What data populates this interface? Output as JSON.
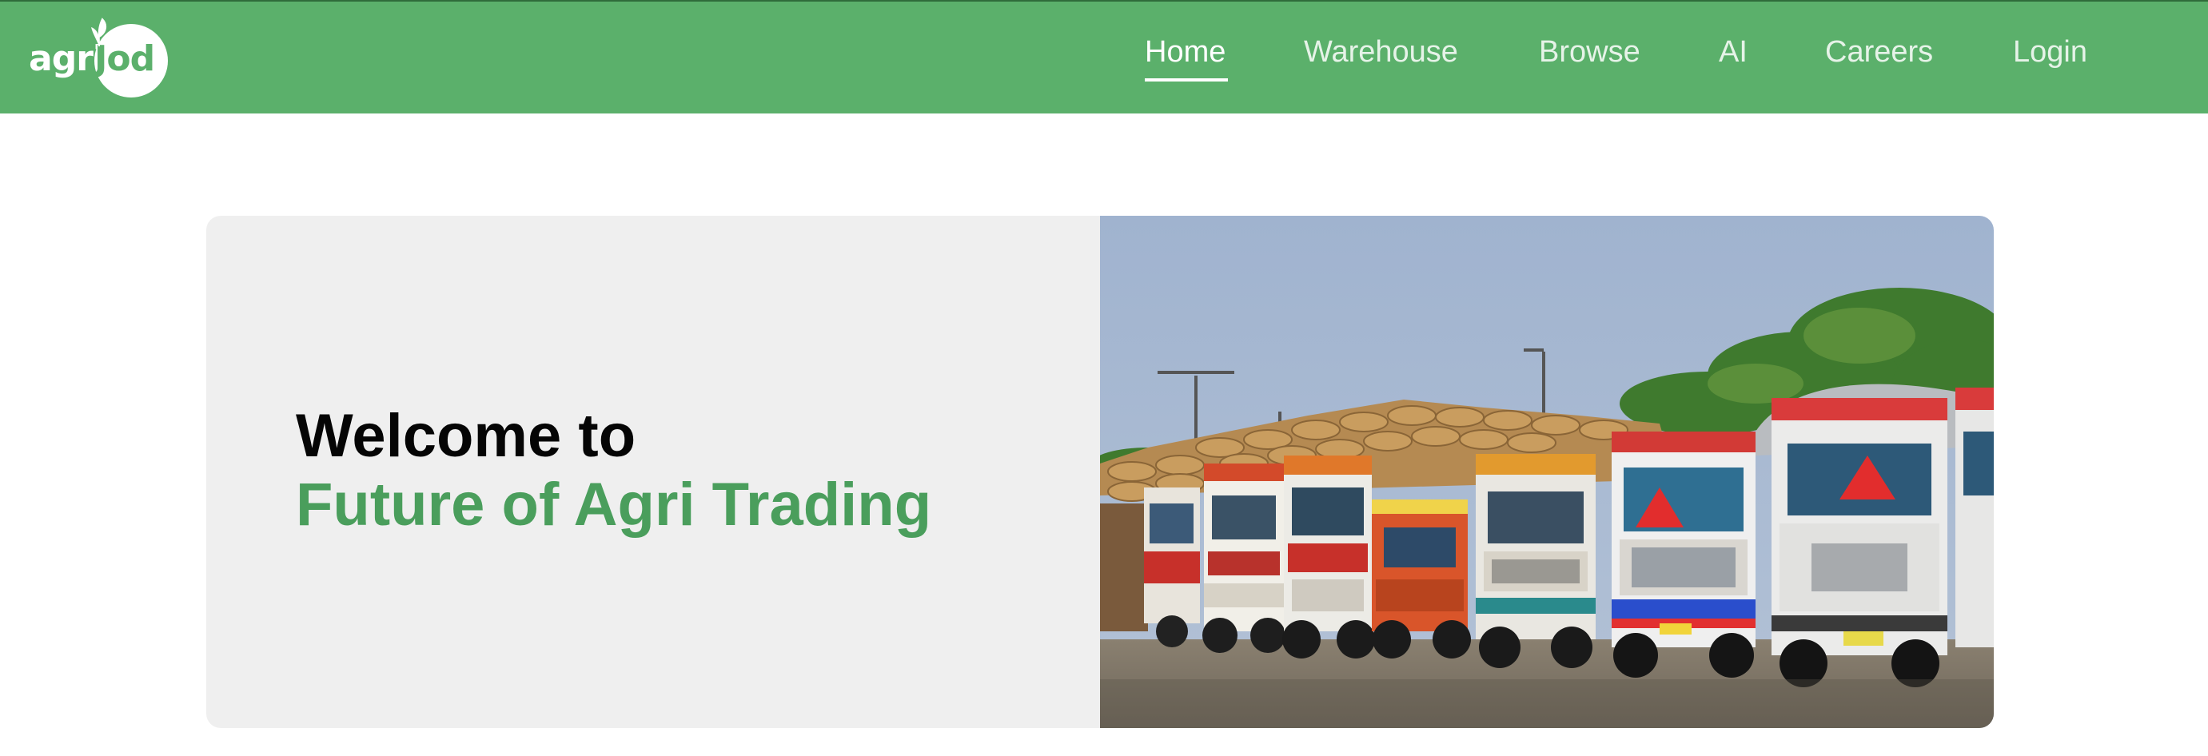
{
  "brand": {
    "logo_part1": "agri",
    "logo_part2": "Jod",
    "green": "#5bb06b",
    "dark_green": "#4a9e5c"
  },
  "nav": {
    "items": [
      {
        "label": "Home",
        "active": true
      },
      {
        "label": "Warehouse",
        "active": false
      },
      {
        "label": "Browse",
        "active": false
      },
      {
        "label": "AI",
        "active": false
      },
      {
        "label": "Careers",
        "active": false
      },
      {
        "label": "Login",
        "active": false
      }
    ]
  },
  "hero": {
    "line1": "Welcome to",
    "line2": "Future of Agri Trading",
    "panel_bg": "#efefef",
    "image_subject": "colorful-trucks-at-grain-market"
  }
}
